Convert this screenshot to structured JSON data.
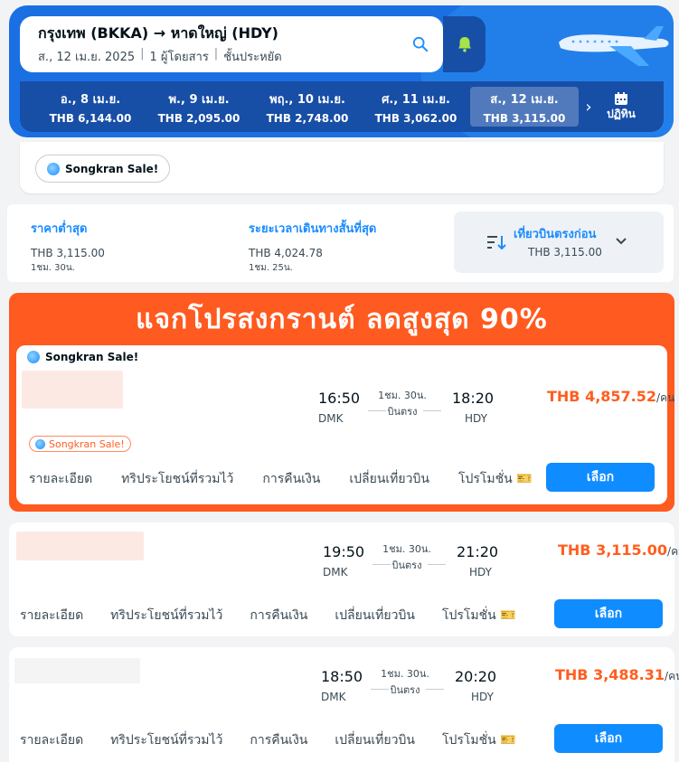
{
  "search": {
    "route": "กรุงเทพ (BKKA) → หาดใหญ่ (HDY)",
    "date": "ส., 12 เม.ย. 2025",
    "passengers": "1 ผู้โดยสาร",
    "cabin": "ชั้นประหยัด"
  },
  "date_strip": [
    {
      "day": "อ., 8 เม.ย.",
      "price": "THB 6,144.00"
    },
    {
      "day": "พ., 9 เม.ย.",
      "price": "THB 2,095.00"
    },
    {
      "day": "พฤ., 10 เม.ย.",
      "price": "THB 2,748.00"
    },
    {
      "day": "ศ., 11 เม.ย.",
      "price": "THB 3,062.00"
    },
    {
      "day": "ส., 12 เม.ย.",
      "price": "THB 3,115.00"
    }
  ],
  "calendar_label": "ปฏิทิน",
  "sale_chip": "Songkran Sale!",
  "sort": {
    "cheapest": {
      "title": "ราคาต่ำสุด",
      "price": "THB 3,115.00",
      "duration": "1ชม. 30น."
    },
    "shortest": {
      "title": "ระยะเวลาเดินทางสั้นที่สุด",
      "price": "THB 4,024.78",
      "duration": "1ชม. 25น."
    },
    "direct": {
      "title": "เที่ยวบินตรงก่อน",
      "price": "THB 3,115.00"
    }
  },
  "promo_banner": "แจกโปรสงกรานต์   ลดสูงสุด 90%",
  "tabs": [
    "รายละเอียด",
    "ทริประโยชน์ที่รวมไว้",
    "การคืนเงิน",
    "เปลี่ยนเที่ยวบิน",
    "โปรโมชั่น"
  ],
  "select_label": "เลือก",
  "flights": [
    {
      "tag": "Songkran Sale!",
      "badge": "Songkran Sale!",
      "dep": "16:50",
      "dep_code": "DMK",
      "arr": "18:20",
      "arr_code": "HDY",
      "duration": "1ชม. 30น.",
      "type": "บินตรง",
      "price": "THB 4,857.52",
      "unit": "/คน"
    },
    {
      "dep": "19:50",
      "dep_code": "DMK",
      "arr": "21:20",
      "arr_code": "HDY",
      "duration": "1ชม. 30น.",
      "type": "บินตรง",
      "price": "THB 3,115.00",
      "unit": "/คน"
    },
    {
      "dep": "18:50",
      "dep_code": "DMK",
      "arr": "20:20",
      "arr_code": "HDY",
      "duration": "1ชม. 30น.",
      "type": "บินตรง",
      "price": "THB 3,488.31",
      "unit": "/คน"
    }
  ],
  "colors": {
    "primary": "#1a6fe3",
    "promo": "#ff5a1f",
    "price": "#ff5e1f",
    "button": "#0f8cff"
  }
}
